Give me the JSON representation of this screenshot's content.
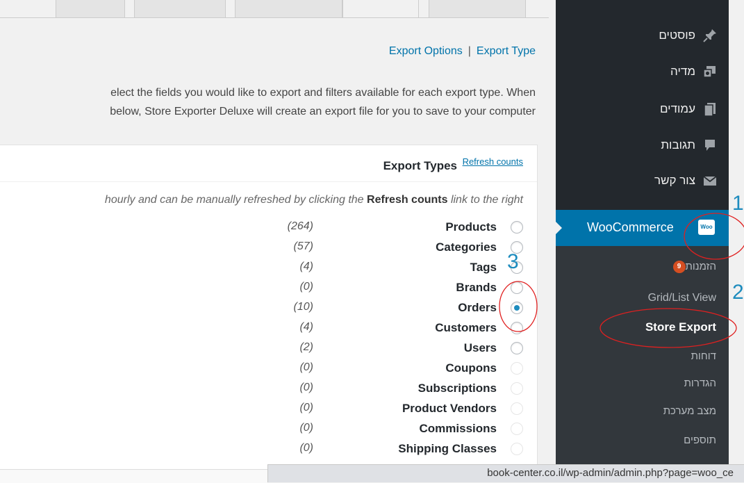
{
  "subnav": {
    "export_options": "Export Options",
    "separator": "|",
    "export_type": "Export Type"
  },
  "description": {
    "line1": "elect the fields you would like to export and filters available for each export type. When",
    "line2": "below, Store Exporter Deluxe will create an export file for you to save to your computer"
  },
  "panel": {
    "title": "Export Types",
    "refresh_link": "Refresh counts",
    "note_before": "hourly and can be manually refreshed by clicking the ",
    "note_bold": "Refresh counts",
    "note_after": " link to the right"
  },
  "export_types": [
    {
      "label": "Products",
      "count": "(264)"
    },
    {
      "label": "Categories",
      "count": "(57)"
    },
    {
      "label": "Tags",
      "count": "(4)"
    },
    {
      "label": "Brands",
      "count": "(0)"
    },
    {
      "label": "Orders",
      "count": "(10)"
    },
    {
      "label": "Customers",
      "count": "(4)"
    },
    {
      "label": "Users",
      "count": "(2)"
    },
    {
      "label": "Coupons",
      "count": "(0)"
    },
    {
      "label": "Subscriptions",
      "count": "(0)"
    },
    {
      "label": "Product Vendors",
      "count": "(0)"
    },
    {
      "label": "Commissions",
      "count": "(0)"
    },
    {
      "label": "Shipping Classes",
      "count": "(0)"
    }
  ],
  "selected_export_type": "Orders",
  "sidebar": {
    "items": [
      {
        "label": "פוסטים",
        "icon": "pin-icon"
      },
      {
        "label": "מדיה",
        "icon": "media-icon"
      },
      {
        "label": "עמודים",
        "icon": "pages-icon"
      },
      {
        "label": "תגובות",
        "icon": "comments-icon"
      },
      {
        "label": "צור קשר",
        "icon": "mail-icon"
      }
    ],
    "woocommerce": {
      "label": "WooCommerce",
      "icon_text": "Woo"
    },
    "submenu": [
      {
        "label": "הזמנות",
        "badge": "9"
      },
      {
        "label": "Grid/List View"
      },
      {
        "label": "Store Export"
      },
      {
        "label": "דוחות"
      },
      {
        "label": "הגדרות"
      },
      {
        "label": "מצב מערכת"
      },
      {
        "label": "תוספים"
      }
    ]
  },
  "annotations": {
    "one": "1",
    "two": "2",
    "three": "3"
  },
  "statusbar": {
    "url": "book-center.co.il/wp-admin/admin.php?page=woo_ce"
  },
  "colors": {
    "sidebar_bg": "#23282d",
    "submenu_bg": "#32373c",
    "accent": "#0073aa",
    "annotation_red": "#e02020",
    "badge": "#d54e21"
  }
}
